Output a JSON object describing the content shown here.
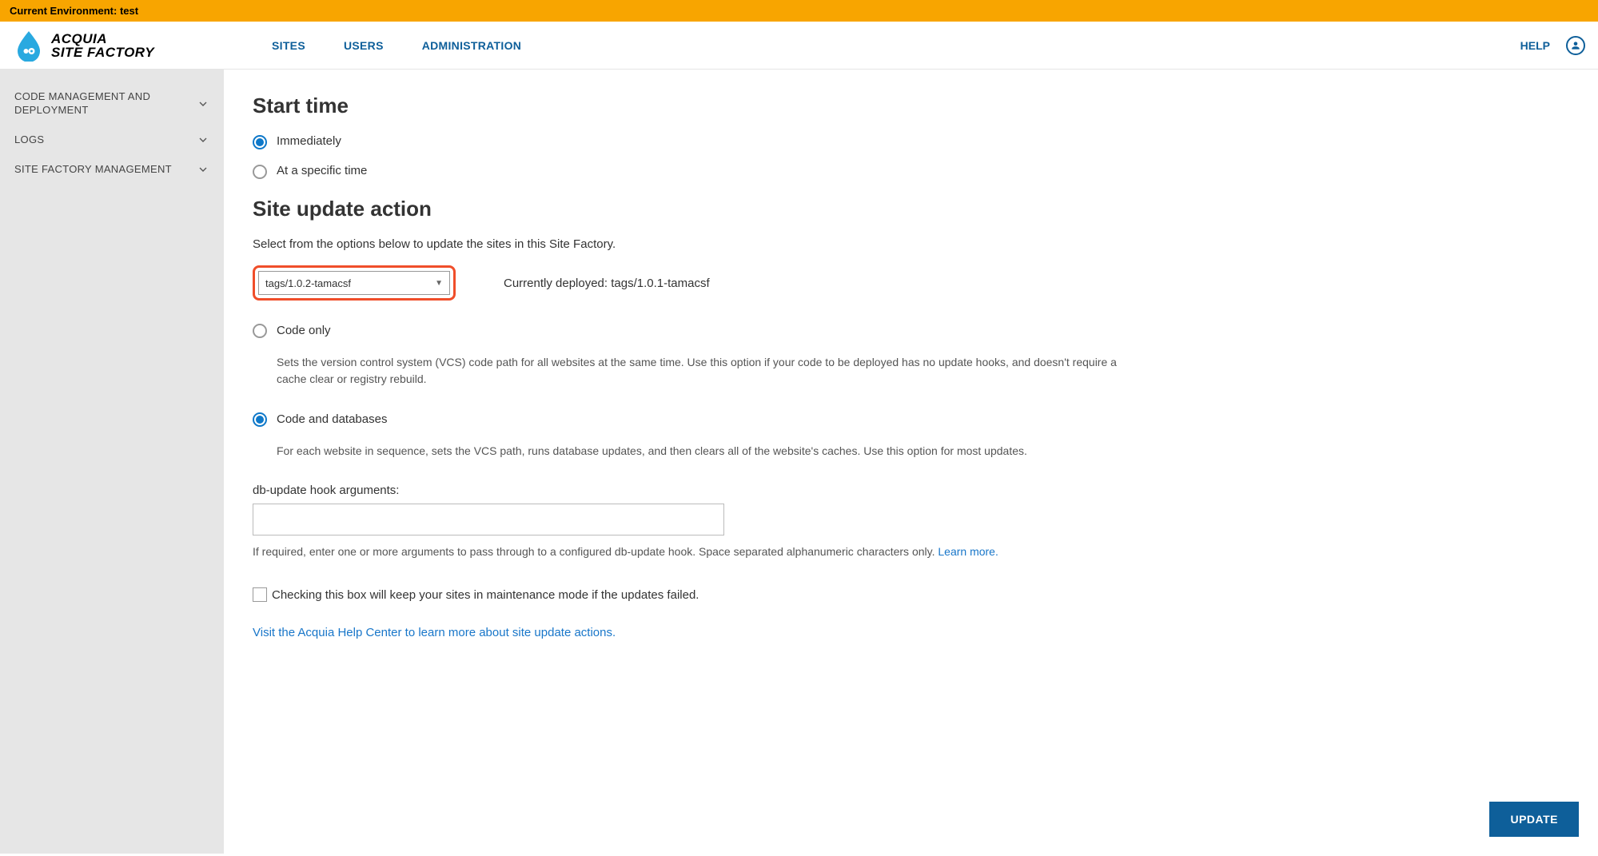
{
  "env_banner": "Current Environment: test",
  "logo": {
    "line1": "ACQUIA",
    "line2": "SITE FACTORY"
  },
  "nav": {
    "sites": "SITES",
    "users": "USERS",
    "admin": "ADMINISTRATION",
    "help": "HELP"
  },
  "sidebar": {
    "items": [
      {
        "label": "CODE MANAGEMENT AND DEPLOYMENT"
      },
      {
        "label": "LOGS"
      },
      {
        "label": "SITE FACTORY MANAGEMENT"
      }
    ]
  },
  "main": {
    "start_time_heading": "Start time",
    "radio_immediately": "Immediately",
    "radio_specific": "At a specific time",
    "action_heading": "Site update action",
    "action_instruct": "Select from the options below to update the sites in this Site Factory.",
    "select_value": "tags/1.0.2-tamacsf",
    "deployed_label": "Currently deployed: tags/1.0.1-tamacsf",
    "code_only_label": "Code only",
    "code_only_desc": "Sets the version control system (VCS) code path for all websites at the same time. Use this option if your code to be deployed has no update hooks, and doesn't require a cache clear or registry rebuild.",
    "code_db_label": "Code and databases",
    "code_db_desc": "For each website in sequence, sets the VCS path, runs database updates, and then clears all of the website's caches. Use this option for most updates.",
    "hook_label": "db-update hook arguments:",
    "hook_helper": "If required, enter one or more arguments to pass through to a configured db-update hook. Space separated alphanumeric characters only. ",
    "learn_more": "Learn more.",
    "maint_label": "Checking this box will keep your sites in maintenance mode if the updates failed.",
    "help_link": "Visit the Acquia Help Center to learn more about site update actions.",
    "update_btn": "UPDATE"
  }
}
